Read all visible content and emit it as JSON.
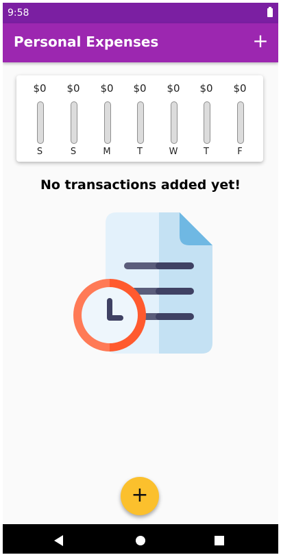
{
  "status_bar": {
    "time": "9:58",
    "battery_icon": "battery-full-icon"
  },
  "app_bar": {
    "title": "Personal Expenses",
    "add_icon": "plus-icon",
    "add_glyph": "+"
  },
  "chart": {
    "days": [
      {
        "label": "S",
        "amount": "$0",
        "fill_fraction": 0
      },
      {
        "label": "S",
        "amount": "$0",
        "fill_fraction": 0
      },
      {
        "label": "M",
        "amount": "$0",
        "fill_fraction": 0
      },
      {
        "label": "T",
        "amount": "$0",
        "fill_fraction": 0
      },
      {
        "label": "W",
        "amount": "$0",
        "fill_fraction": 0
      },
      {
        "label": "T",
        "amount": "$0",
        "fill_fraction": 0
      },
      {
        "label": "F",
        "amount": "$0",
        "fill_fraction": 0
      }
    ]
  },
  "empty_state": {
    "message": "No transactions added yet!",
    "illustration_icon": "document-clock-icon"
  },
  "fab": {
    "glyph": "+",
    "icon": "plus-icon"
  },
  "nav": {
    "back_icon": "back-triangle-icon",
    "home_icon": "home-circle-icon",
    "recents_icon": "recents-square-icon"
  },
  "colors": {
    "primary": "#9c27b0",
    "primary_dark": "#7b1fa2",
    "accent": "#fbc02d",
    "bar_track": "#dcdcdc"
  }
}
